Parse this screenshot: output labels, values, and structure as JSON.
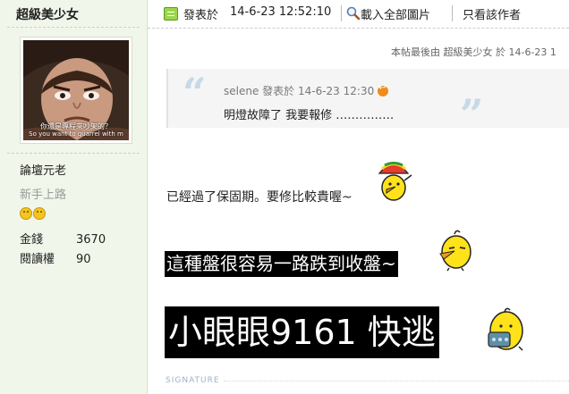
{
  "author": {
    "name": "超級美少女",
    "avatar_caption_line1": "你還是專程來吵架的？",
    "avatar_caption_line2": "So you want to quarrel with m",
    "rank": "論壇元老",
    "level": "新手上路",
    "stats": [
      {
        "label": "金錢",
        "value": "3670"
      },
      {
        "label": "閱讀權",
        "value": "90"
      }
    ]
  },
  "topbar": {
    "posted_label": "發表於",
    "posted_time": "14-6-23 12:52:10",
    "load_images": "載入全部圖片",
    "author_only": "只看該作者"
  },
  "edited_note": "本帖最後由 超級美少女 於 14-6-23 1",
  "quote": {
    "meta": "selene 發表於 14-6-23 12:30",
    "text": "明燈故障了 我要報修 ……………"
  },
  "content": {
    "line1": "已經過了保固期。要修比較貴喔~",
    "line2": "這種盤很容易一路跌到收盤~",
    "line3": "小眼眼9161 快逃"
  },
  "signature_label": "SIGNATURE",
  "colors": {
    "sidebar_bg": "#f1f6ea",
    "quote_mark": "#c7d9e6",
    "highlight_bg": "#000000",
    "highlight_text": "#ffffff"
  }
}
